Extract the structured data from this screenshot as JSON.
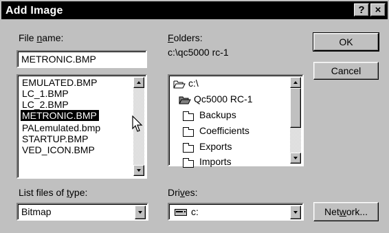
{
  "window": {
    "title": "Add Image",
    "help_glyph": "?",
    "close_glyph": "×"
  },
  "file_name": {
    "label_pre": "File ",
    "label_u": "n",
    "label_post": "ame:",
    "value": "METRONIC.BMP",
    "files": [
      "EMULATED.BMP",
      "LC_1.BMP",
      "LC_2.BMP",
      "METRONIC.BMP",
      "PALemulated.bmp",
      "STARTUP.BMP",
      "VED_ICON.BMP"
    ],
    "selected": "METRONIC.BMP"
  },
  "folders": {
    "label_u": "F",
    "label_post": "olders:",
    "path": "c:\\qc5000 rc-1",
    "items": [
      "c:\\",
      "Qc5000 RC-1",
      "Backups",
      "Coefficients",
      "Exports",
      "Imports"
    ]
  },
  "file_type": {
    "label_pre": "List files of ",
    "label_u": "t",
    "label_post": "ype:",
    "value": "Bitmap"
  },
  "drives": {
    "label_pre": "Dri",
    "label_u": "v",
    "label_post": "es:",
    "value": "c:"
  },
  "buttons": {
    "ok": "OK",
    "cancel": "Cancel",
    "network_pre": "Net",
    "network_u": "w",
    "network_post": "ork..."
  }
}
